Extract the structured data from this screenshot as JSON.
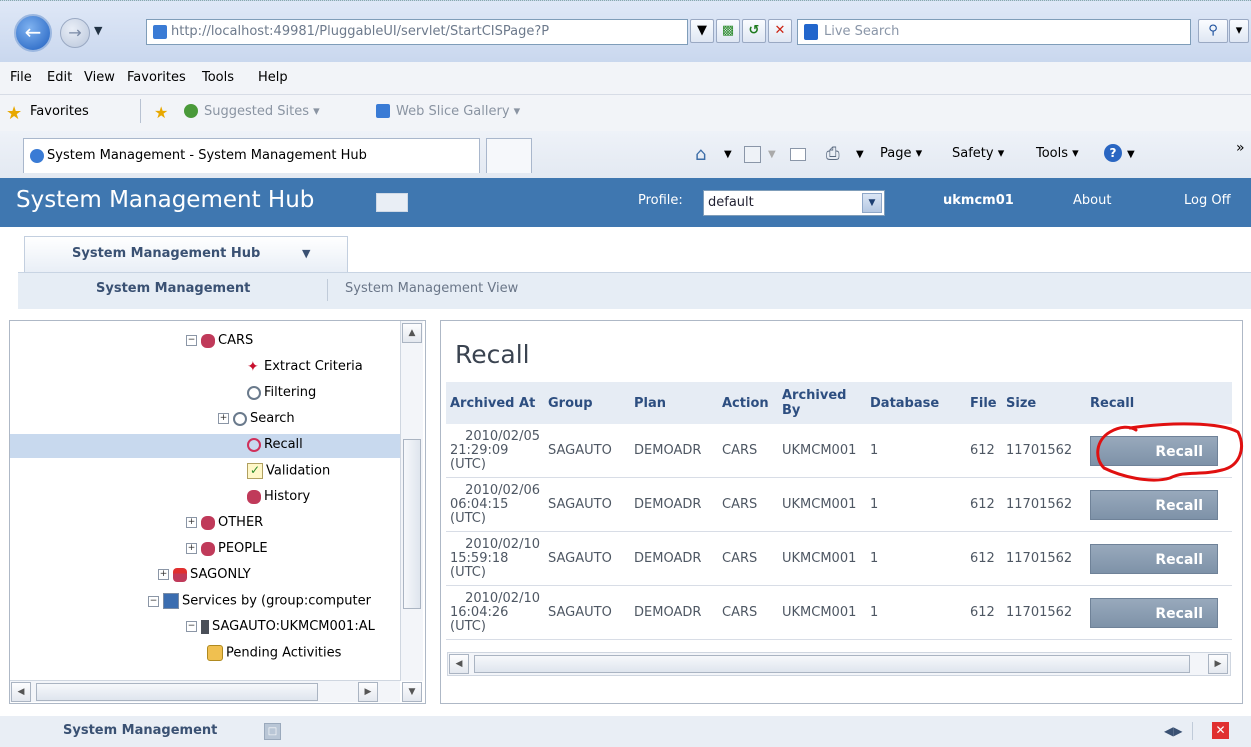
{
  "browser": {
    "url": "http://localhost:49981/PluggableUI/servlet/StartCISPage?P",
    "url_host": "localhost",
    "search_placeholder": "Live Search",
    "menu": [
      "File",
      "Edit",
      "View",
      "Favorites",
      "Tools",
      "Help"
    ],
    "favorites_label": "Favorites",
    "suggested_sites": "Suggested Sites ▾",
    "web_slice": "Web Slice Gallery ▾",
    "tab_title": "System Management - System Management Hub",
    "cmd_page": "Page ▾",
    "cmd_safety": "Safety ▾",
    "cmd_tools": "Tools ▾",
    "cmd_more": "»"
  },
  "app": {
    "title": "System Management Hub",
    "profile_label": "Profile:",
    "profile_value": "default",
    "user": "ukmcm01",
    "about": "About",
    "logoff": "Log Off",
    "hub_tab": "System Management Hub",
    "subnav": [
      "System Management",
      "System Management View"
    ],
    "footer_title": "System Management"
  },
  "tree": {
    "items": [
      {
        "label": "CARS"
      },
      {
        "label": "Extract Criteria"
      },
      {
        "label": "Filtering"
      },
      {
        "label": "Search"
      },
      {
        "label": "Recall"
      },
      {
        "label": "Validation"
      },
      {
        "label": "History"
      },
      {
        "label": "OTHER"
      },
      {
        "label": "PEOPLE"
      },
      {
        "label": "SAGONLY"
      },
      {
        "label": "Services by (group:computer"
      },
      {
        "label": "SAGAUTO:UKMCM001:AL"
      },
      {
        "label": "Pending Activities"
      }
    ]
  },
  "recall": {
    "title": "Recall",
    "headers": [
      "Archived At",
      "Group",
      "Plan",
      "Action",
      "Archived By",
      "Database",
      "File",
      "Size",
      "Recall"
    ],
    "rows": [
      {
        "at1": "2010/02/05",
        "at2": "21:29:09",
        "at3": "(UTC)",
        "group": "SAGAUTO",
        "plan": "DEMOADR",
        "action": "CARS",
        "by": "UKMCM001",
        "db": "1",
        "file": "612",
        "size": "11701562",
        "btn": "Recall"
      },
      {
        "at1": "2010/02/06",
        "at2": "06:04:15",
        "at3": "(UTC)",
        "group": "SAGAUTO",
        "plan": "DEMOADR",
        "action": "CARS",
        "by": "UKMCM001",
        "db": "1",
        "file": "612",
        "size": "11701562",
        "btn": "Recall"
      },
      {
        "at1": "2010/02/10",
        "at2": "15:59:18",
        "at3": "(UTC)",
        "group": "SAGAUTO",
        "plan": "DEMOADR",
        "action": "CARS",
        "by": "UKMCM001",
        "db": "1",
        "file": "612",
        "size": "11701562",
        "btn": "Recall"
      },
      {
        "at1": "2010/02/10",
        "at2": "16:04:26",
        "at3": "(UTC)",
        "group": "SAGAUTO",
        "plan": "DEMOADR",
        "action": "CARS",
        "by": "UKMCM001",
        "db": "1",
        "file": "612",
        "size": "11701562",
        "btn": "Recall"
      }
    ]
  },
  "colors": {
    "header_blue": "#3f77b0",
    "annotation_red": "#e01010",
    "recall_button": "#8a9db2"
  }
}
